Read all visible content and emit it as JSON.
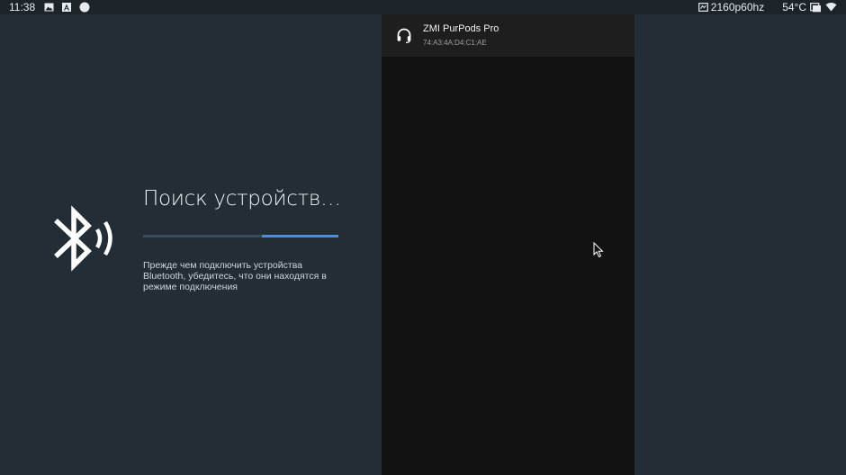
{
  "status_bar": {
    "time": "11:38",
    "left_icons": [
      "photo-icon",
      "app-a-icon",
      "circle-icon"
    ],
    "resolution": "2160p60hz",
    "temperature": "54°C",
    "right_icons": [
      "hdmi-icon",
      "notification-icon",
      "wifi-icon"
    ]
  },
  "setup": {
    "title": "Поиск устройств…",
    "progress_fraction": 0.39,
    "progress_start": 0.61,
    "description": "Прежде чем подключить устройства Bluetooth, убедитесь, что они находятся в режиме подключения",
    "icon": "bluetooth-searching-icon"
  },
  "devices": [
    {
      "name": "ZMI PurPods Pro",
      "address": "74:A3:4A:D4:C1:AE",
      "icon": "headset-icon"
    }
  ],
  "colors": {
    "background": "#222d35",
    "panel": "#121212",
    "selected_item": "#1e1e1e",
    "accent": "#4a90d9"
  }
}
